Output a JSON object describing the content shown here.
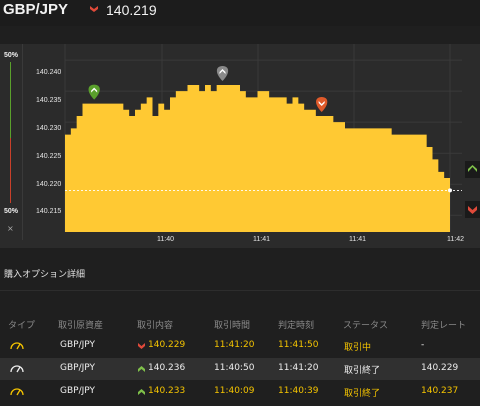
{
  "header": {
    "pair": "GBP/JPY",
    "rate": "140.219",
    "direction": "down",
    "colors": {
      "up": "#7fc04a",
      "down": "#e04a3a"
    }
  },
  "sidebar": {
    "top_pct": "50%",
    "bottom_pct": "50%",
    "close": "×"
  },
  "chart_data": {
    "type": "area",
    "color": "#ffc933",
    "y_ticks": [
      "140.240",
      "140.235",
      "140.230",
      "140.225",
      "140.220",
      "140.215"
    ],
    "x_ticks": [
      "11:40",
      "11:41",
      "11:41",
      "11:42"
    ],
    "ylim": [
      140.2123,
      140.2426
    ],
    "current_level": 140.219,
    "series": [
      140.228,
      140.229,
      140.231,
      140.233,
      140.233,
      140.233,
      140.233,
      140.233,
      140.233,
      140.233,
      140.232,
      140.231,
      140.232,
      140.233,
      140.234,
      140.231,
      140.233,
      140.232,
      140.234,
      140.235,
      140.235,
      140.236,
      140.236,
      140.235,
      140.236,
      140.235,
      140.236,
      140.236,
      140.236,
      140.236,
      140.235,
      140.234,
      140.234,
      140.235,
      140.235,
      140.234,
      140.234,
      140.234,
      140.233,
      140.234,
      140.233,
      140.232,
      140.232,
      140.231,
      140.231,
      140.231,
      140.23,
      140.23,
      140.229,
      140.229,
      140.229,
      140.229,
      140.229,
      140.229,
      140.229,
      140.229,
      140.228,
      140.228,
      140.228,
      140.228,
      140.228,
      140.228,
      140.226,
      140.224,
      140.222,
      140.221,
      140.219
    ],
    "markers": [
      {
        "index": 5,
        "kind": "up",
        "color": "#5aa02c"
      },
      {
        "index": 27,
        "kind": "neutral",
        "color": "#8a8a8a"
      },
      {
        "index": 44,
        "kind": "down",
        "color": "#e05a2a"
      }
    ]
  },
  "section_title": "購入オプション詳細",
  "table": {
    "headers": [
      "タイプ",
      "取引原資産",
      "取引内容",
      "取引時間",
      "判定時刻",
      "ステータス",
      "判定レート"
    ],
    "rows": [
      {
        "pair": "GBP/JPY",
        "dir": "down",
        "content": "140.229",
        "trade_time": "11:41:20",
        "judge_time": "11:41:50",
        "status": "取引中",
        "judge_rate": "-"
      },
      {
        "pair": "GBP/JPY",
        "dir": "up",
        "content": "140.236",
        "trade_time": "11:40:50",
        "judge_time": "11:41:20",
        "status": "取引終了",
        "judge_rate": "140.229"
      },
      {
        "pair": "GBP/JPY",
        "dir": "up",
        "content": "140.233",
        "trade_time": "11:40:09",
        "judge_time": "11:40:39",
        "status": "取引終了",
        "judge_rate": "140.237"
      }
    ]
  }
}
